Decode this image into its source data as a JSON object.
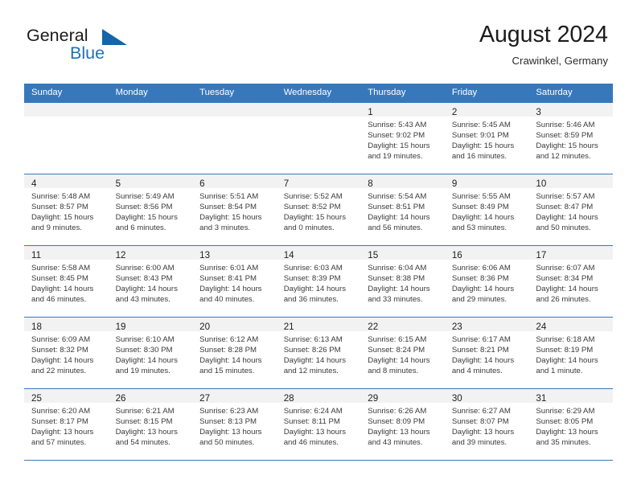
{
  "brand": {
    "name_part1": "General",
    "name_part2": "Blue",
    "triangle_color": "#1565a8",
    "blue_color": "#1e72b8"
  },
  "header": {
    "title": "August 2024",
    "subtitle": "Crawinkel, Germany"
  },
  "theme": {
    "header_bar_color": "#3778bd",
    "daynum_band_color": "#f2f2f2",
    "grid_line_color": "#3778bd",
    "text_color": "#3a3a3a"
  },
  "weekday_headers": [
    "Sunday",
    "Monday",
    "Tuesday",
    "Wednesday",
    "Thursday",
    "Friday",
    "Saturday"
  ],
  "weeks": [
    [
      {
        "day": "",
        "lines": []
      },
      {
        "day": "",
        "lines": []
      },
      {
        "day": "",
        "lines": []
      },
      {
        "day": "",
        "lines": []
      },
      {
        "day": "1",
        "lines": [
          "Sunrise: 5:43 AM",
          "Sunset: 9:02 PM",
          "Daylight: 15 hours",
          "and 19 minutes."
        ]
      },
      {
        "day": "2",
        "lines": [
          "Sunrise: 5:45 AM",
          "Sunset: 9:01 PM",
          "Daylight: 15 hours",
          "and 16 minutes."
        ]
      },
      {
        "day": "3",
        "lines": [
          "Sunrise: 5:46 AM",
          "Sunset: 8:59 PM",
          "Daylight: 15 hours",
          "and 12 minutes."
        ]
      }
    ],
    [
      {
        "day": "4",
        "lines": [
          "Sunrise: 5:48 AM",
          "Sunset: 8:57 PM",
          "Daylight: 15 hours",
          "and 9 minutes."
        ]
      },
      {
        "day": "5",
        "lines": [
          "Sunrise: 5:49 AM",
          "Sunset: 8:56 PM",
          "Daylight: 15 hours",
          "and 6 minutes."
        ]
      },
      {
        "day": "6",
        "lines": [
          "Sunrise: 5:51 AM",
          "Sunset: 8:54 PM",
          "Daylight: 15 hours",
          "and 3 minutes."
        ]
      },
      {
        "day": "7",
        "lines": [
          "Sunrise: 5:52 AM",
          "Sunset: 8:52 PM",
          "Daylight: 15 hours",
          "and 0 minutes."
        ]
      },
      {
        "day": "8",
        "lines": [
          "Sunrise: 5:54 AM",
          "Sunset: 8:51 PM",
          "Daylight: 14 hours",
          "and 56 minutes."
        ]
      },
      {
        "day": "9",
        "lines": [
          "Sunrise: 5:55 AM",
          "Sunset: 8:49 PM",
          "Daylight: 14 hours",
          "and 53 minutes."
        ]
      },
      {
        "day": "10",
        "lines": [
          "Sunrise: 5:57 AM",
          "Sunset: 8:47 PM",
          "Daylight: 14 hours",
          "and 50 minutes."
        ]
      }
    ],
    [
      {
        "day": "11",
        "lines": [
          "Sunrise: 5:58 AM",
          "Sunset: 8:45 PM",
          "Daylight: 14 hours",
          "and 46 minutes."
        ]
      },
      {
        "day": "12",
        "lines": [
          "Sunrise: 6:00 AM",
          "Sunset: 8:43 PM",
          "Daylight: 14 hours",
          "and 43 minutes."
        ]
      },
      {
        "day": "13",
        "lines": [
          "Sunrise: 6:01 AM",
          "Sunset: 8:41 PM",
          "Daylight: 14 hours",
          "and 40 minutes."
        ]
      },
      {
        "day": "14",
        "lines": [
          "Sunrise: 6:03 AM",
          "Sunset: 8:39 PM",
          "Daylight: 14 hours",
          "and 36 minutes."
        ]
      },
      {
        "day": "15",
        "lines": [
          "Sunrise: 6:04 AM",
          "Sunset: 8:38 PM",
          "Daylight: 14 hours",
          "and 33 minutes."
        ]
      },
      {
        "day": "16",
        "lines": [
          "Sunrise: 6:06 AM",
          "Sunset: 8:36 PM",
          "Daylight: 14 hours",
          "and 29 minutes."
        ]
      },
      {
        "day": "17",
        "lines": [
          "Sunrise: 6:07 AM",
          "Sunset: 8:34 PM",
          "Daylight: 14 hours",
          "and 26 minutes."
        ]
      }
    ],
    [
      {
        "day": "18",
        "lines": [
          "Sunrise: 6:09 AM",
          "Sunset: 8:32 PM",
          "Daylight: 14 hours",
          "and 22 minutes."
        ]
      },
      {
        "day": "19",
        "lines": [
          "Sunrise: 6:10 AM",
          "Sunset: 8:30 PM",
          "Daylight: 14 hours",
          "and 19 minutes."
        ]
      },
      {
        "day": "20",
        "lines": [
          "Sunrise: 6:12 AM",
          "Sunset: 8:28 PM",
          "Daylight: 14 hours",
          "and 15 minutes."
        ]
      },
      {
        "day": "21",
        "lines": [
          "Sunrise: 6:13 AM",
          "Sunset: 8:26 PM",
          "Daylight: 14 hours",
          "and 12 minutes."
        ]
      },
      {
        "day": "22",
        "lines": [
          "Sunrise: 6:15 AM",
          "Sunset: 8:24 PM",
          "Daylight: 14 hours",
          "and 8 minutes."
        ]
      },
      {
        "day": "23",
        "lines": [
          "Sunrise: 6:17 AM",
          "Sunset: 8:21 PM",
          "Daylight: 14 hours",
          "and 4 minutes."
        ]
      },
      {
        "day": "24",
        "lines": [
          "Sunrise: 6:18 AM",
          "Sunset: 8:19 PM",
          "Daylight: 14 hours",
          "and 1 minute."
        ]
      }
    ],
    [
      {
        "day": "25",
        "lines": [
          "Sunrise: 6:20 AM",
          "Sunset: 8:17 PM",
          "Daylight: 13 hours",
          "and 57 minutes."
        ]
      },
      {
        "day": "26",
        "lines": [
          "Sunrise: 6:21 AM",
          "Sunset: 8:15 PM",
          "Daylight: 13 hours",
          "and 54 minutes."
        ]
      },
      {
        "day": "27",
        "lines": [
          "Sunrise: 6:23 AM",
          "Sunset: 8:13 PM",
          "Daylight: 13 hours",
          "and 50 minutes."
        ]
      },
      {
        "day": "28",
        "lines": [
          "Sunrise: 6:24 AM",
          "Sunset: 8:11 PM",
          "Daylight: 13 hours",
          "and 46 minutes."
        ]
      },
      {
        "day": "29",
        "lines": [
          "Sunrise: 6:26 AM",
          "Sunset: 8:09 PM",
          "Daylight: 13 hours",
          "and 43 minutes."
        ]
      },
      {
        "day": "30",
        "lines": [
          "Sunrise: 6:27 AM",
          "Sunset: 8:07 PM",
          "Daylight: 13 hours",
          "and 39 minutes."
        ]
      },
      {
        "day": "31",
        "lines": [
          "Sunrise: 6:29 AM",
          "Sunset: 8:05 PM",
          "Daylight: 13 hours",
          "and 35 minutes."
        ]
      }
    ]
  ]
}
